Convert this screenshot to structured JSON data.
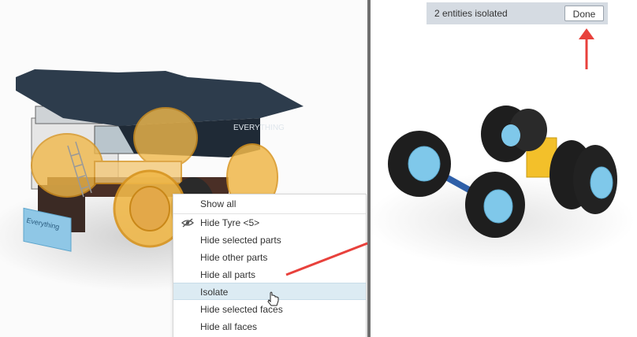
{
  "context_menu": {
    "items": [
      {
        "label": "Show all"
      },
      {
        "label": "Hide Tyre <5>",
        "icon": "hide-eye-icon"
      },
      {
        "label": "Hide selected parts"
      },
      {
        "label": "Hide other parts"
      },
      {
        "label": "Hide all parts"
      },
      {
        "label": "Isolate",
        "highlighted": true
      },
      {
        "label": "Hide selected faces"
      },
      {
        "label": "Hide all faces"
      }
    ]
  },
  "isolate_bar": {
    "status_text": "2 entities isolated",
    "done_label": "Done"
  },
  "truck_logo_text": "Everything",
  "colors": {
    "highlight": "#f0b84a",
    "menu_hover": "#dcebf3",
    "arrow": "#e8413c",
    "dump_body": "#2d3c4c",
    "rim": "#7fc8ea",
    "axle": "#2e5fa8",
    "block": "#f3c02a"
  }
}
